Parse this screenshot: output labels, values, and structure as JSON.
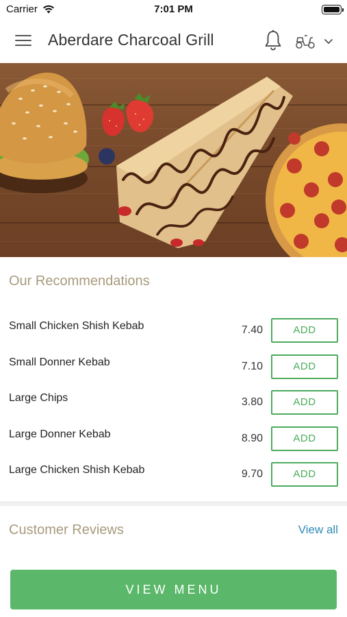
{
  "status_bar": {
    "carrier": "Carrier",
    "time": "7:01 PM"
  },
  "header": {
    "title": "Aberdare Charcoal Grill",
    "icons": [
      "menu-icon",
      "bell-icon",
      "scooter-icon",
      "chevron-down-icon"
    ]
  },
  "hero": {
    "description_icons": [
      "burger",
      "crepe",
      "strawberries",
      "blueberry",
      "pizza"
    ]
  },
  "recommendations": {
    "title": "Our Recommendations",
    "add_label": "ADD",
    "items": [
      {
        "name": "Small Chicken Shish Kebab",
        "price": "7.40"
      },
      {
        "name": "Small Donner Kebab",
        "price": "7.10"
      },
      {
        "name": "Large Chips",
        "price": "3.80"
      },
      {
        "name": "Large Donner Kebab",
        "price": "8.90"
      },
      {
        "name": "Large Chicken Shish Kebab",
        "price": "9.70"
      }
    ]
  },
  "reviews": {
    "title": "Customer Reviews",
    "view_all": "View all"
  },
  "footer": {
    "view_menu": "VIEW MENU"
  },
  "colors": {
    "accent_green": "#5bb86a",
    "add_green": "#4caa5e",
    "link_blue": "#2d8bb8",
    "section_title": "#a89a7c"
  }
}
